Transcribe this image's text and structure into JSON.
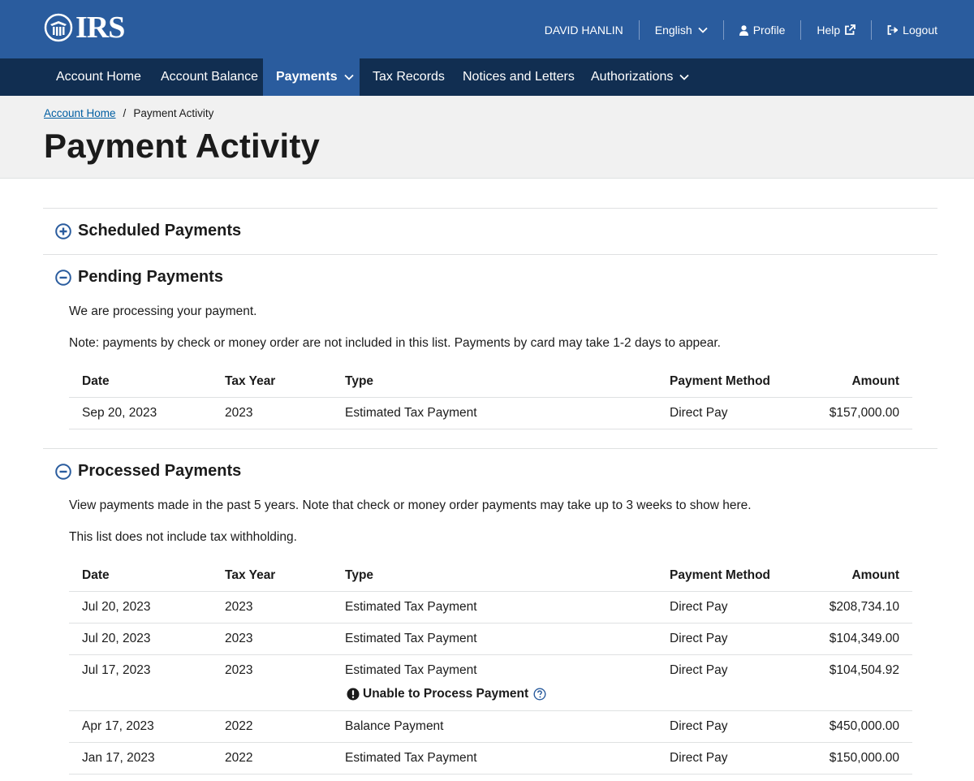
{
  "header": {
    "logo_text": "IRS",
    "user_name": "DAVID HANLIN",
    "language": "English",
    "profile": "Profile",
    "help": "Help",
    "logout": "Logout"
  },
  "nav": {
    "items": [
      {
        "label": "Account Home"
      },
      {
        "label": "Account Balance"
      },
      {
        "label": "Payments"
      },
      {
        "label": "Tax Records"
      },
      {
        "label": "Notices and Letters"
      },
      {
        "label": "Authorizations"
      }
    ]
  },
  "breadcrumb": {
    "home": "Account Home",
    "separator": "/",
    "current": "Payment Activity"
  },
  "page_title": "Payment Activity",
  "columns": {
    "date": "Date",
    "tax_year": "Tax Year",
    "type": "Type",
    "method": "Payment Method",
    "amount": "Amount"
  },
  "scheduled": {
    "title": "Scheduled Payments"
  },
  "pending": {
    "title": "Pending Payments",
    "intro": "We are processing your payment.",
    "note": "Note: payments by check or money order are not included in this list. Payments by card may take 1-2 days to appear.",
    "rows": [
      {
        "date": "Sep 20, 2023",
        "year": "2023",
        "type": "Estimated Tax Payment",
        "method": "Direct Pay",
        "amount": "$157,000.00"
      }
    ]
  },
  "processed": {
    "title": "Processed Payments",
    "intro": "View payments made in the past 5 years. Note that check or money order payments may take up to 3 weeks to show here.",
    "note": "This list does not include tax withholding.",
    "rows": [
      {
        "date": "Jul 20, 2023",
        "year": "2023",
        "type": "Estimated Tax Payment",
        "method": "Direct Pay",
        "amount": "$208,734.10"
      },
      {
        "date": "Jul 20, 2023",
        "year": "2023",
        "type": "Estimated Tax Payment",
        "method": "Direct Pay",
        "amount": "$104,349.00"
      },
      {
        "date": "Jul 17, 2023",
        "year": "2023",
        "type": "Estimated Tax Payment",
        "method": "Direct Pay",
        "amount": "$104,504.92",
        "warning": "Unable to Process Payment"
      },
      {
        "date": "Apr 17, 2023",
        "year": "2022",
        "type": "Balance Payment",
        "method": "Direct Pay",
        "amount": "$450,000.00"
      },
      {
        "date": "Jan 17, 2023",
        "year": "2022",
        "type": "Estimated Tax Payment",
        "method": "Direct Pay",
        "amount": "$150,000.00"
      }
    ]
  },
  "colors": {
    "top_bar": "#2a5c9e",
    "nav_bar": "#112e51",
    "link": "#005ea2",
    "icon": "#2a5c9e"
  }
}
